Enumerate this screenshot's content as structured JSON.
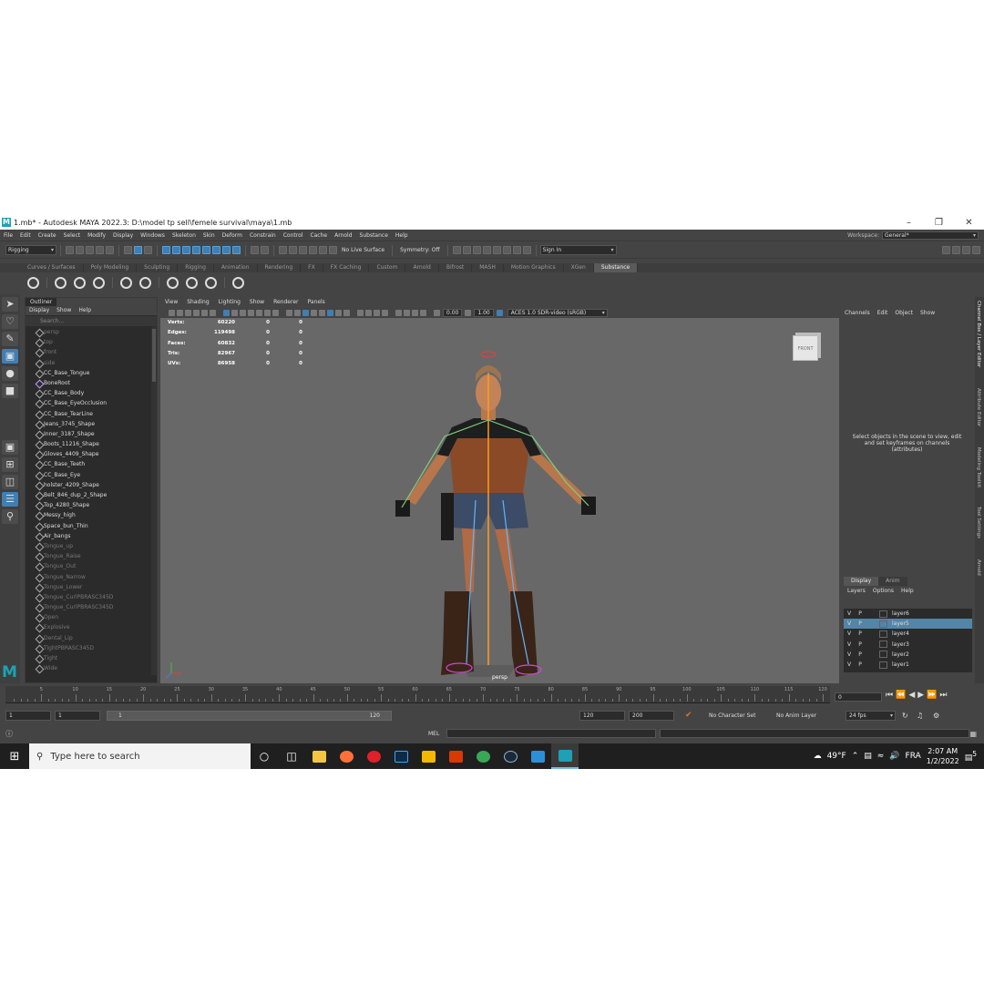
{
  "titlebar": {
    "title": "1.mb* - Autodesk MAYA 2022.3: D:\\model tp sell\\femele survival\\maya\\1.mb",
    "icon": "maya-icon",
    "controls": [
      "minimize-icon",
      "maximize-icon",
      "close-icon"
    ]
  },
  "menubar": {
    "items": [
      "File",
      "Edit",
      "Create",
      "Select",
      "Modify",
      "Display",
      "Windows",
      "Skeleton",
      "Skin",
      "Deform",
      "Constrain",
      "Control",
      "Cache",
      "Arnold",
      "Substance",
      "Help"
    ],
    "workspace_label": "Workspace:",
    "workspace_value": "General*"
  },
  "statusline": {
    "mode": "Rigging",
    "live_surface": "No Live Surface",
    "symmetry": "Symmetry: Off",
    "sign_in": "Sign In"
  },
  "shelf": {
    "tabs": [
      "Curves / Surfaces",
      "Poly Modeling",
      "Sculpting",
      "Rigging",
      "Animation",
      "Rendering",
      "FX",
      "FX Caching",
      "Custom",
      "Arnold",
      "Bifrost",
      "MASH",
      "Motion Graphics",
      "XGen",
      "Substance"
    ],
    "active": "Substance"
  },
  "outliner": {
    "title": "Outliner",
    "menu": [
      "Display",
      "Show",
      "Help"
    ],
    "search_placeholder": "Search...",
    "items": [
      {
        "name": "persp",
        "dim": true
      },
      {
        "name": "top",
        "dim": true
      },
      {
        "name": "front",
        "dim": true
      },
      {
        "name": "side",
        "dim": true
      },
      {
        "name": "CC_Base_Tongue",
        "dim": false
      },
      {
        "name": "BoneRoot",
        "dim": false,
        "joint": true
      },
      {
        "name": "CC_Base_Body",
        "dim": false
      },
      {
        "name": "CC_Base_EyeOcclusion",
        "dim": false
      },
      {
        "name": "CC_Base_TearLine",
        "dim": false
      },
      {
        "name": "Jeans_3745_Shape",
        "dim": false
      },
      {
        "name": "Inner_3187_Shape",
        "dim": false
      },
      {
        "name": "Boots_11216_Shape",
        "dim": false
      },
      {
        "name": "Gloves_4409_Shape",
        "dim": false
      },
      {
        "name": "CC_Base_Teeth",
        "dim": false
      },
      {
        "name": "CC_Base_Eye",
        "dim": false
      },
      {
        "name": "holster_4209_Shape",
        "dim": false
      },
      {
        "name": "Belt_846_dup_2_Shape",
        "dim": false
      },
      {
        "name": "Top_4280_Shape",
        "dim": false
      },
      {
        "name": "Messy_high",
        "dim": false
      },
      {
        "name": "Space_bun_Thin",
        "dim": false
      },
      {
        "name": "Air_bangs",
        "dim": false
      },
      {
        "name": "Tongue_up",
        "dim": true
      },
      {
        "name": "Tongue_Raise",
        "dim": true
      },
      {
        "name": "Tongue_Out",
        "dim": true
      },
      {
        "name": "Tongue_Narrow",
        "dim": true
      },
      {
        "name": "Tongue_Lower",
        "dim": true
      },
      {
        "name": "Tongue_CurlPBRASC345D",
        "dim": true
      },
      {
        "name": "Tongue_CurlPBRASC345D",
        "dim": true
      },
      {
        "name": "Open",
        "dim": true
      },
      {
        "name": "Explosive",
        "dim": true
      },
      {
        "name": "Dental_Lip",
        "dim": true
      },
      {
        "name": "TightPBRASC345D",
        "dim": true
      },
      {
        "name": "Tight",
        "dim": true
      },
      {
        "name": "Wide",
        "dim": true
      }
    ]
  },
  "viewport": {
    "menu": [
      "View",
      "Shading",
      "Lighting",
      "Show",
      "Renderer",
      "Panels"
    ],
    "exposure": "0.00",
    "gamma": "1.00",
    "color_space": "ACES 1.0 SDR-video (sRGB)",
    "hud": [
      {
        "label": "Verts:",
        "v1": "60220",
        "v2": "0",
        "v3": "0"
      },
      {
        "label": "Edges:",
        "v1": "119498",
        "v2": "0",
        "v3": "0"
      },
      {
        "label": "Faces:",
        "v1": "60832",
        "v2": "0",
        "v3": "0"
      },
      {
        "label": "Tris:",
        "v1": "82967",
        "v2": "0",
        "v3": "0"
      },
      {
        "label": "UVs:",
        "v1": "86958",
        "v2": "0",
        "v3": "0"
      }
    ],
    "view_cube": "FRONT",
    "camera": "persp"
  },
  "channelbox": {
    "menu": [
      "Channels",
      "Edit",
      "Object",
      "Show"
    ],
    "hint": "Select objects in the scene to view, edit and set keyframes on channels (attributes)",
    "side_tabs": [
      "Channel Box / Layer Editor",
      "Attribute Editor",
      "Modeling Toolkit",
      "Tool Settings",
      "Arnold"
    ]
  },
  "layers": {
    "tabs": [
      "Display",
      "Anim"
    ],
    "menu": [
      "Layers",
      "Options",
      "Help"
    ],
    "rows": [
      {
        "v": "V",
        "p": "P",
        "name": "layer6",
        "sel": false
      },
      {
        "v": "V",
        "p": "P",
        "name": "layer5",
        "sel": true
      },
      {
        "v": "V",
        "p": "P",
        "name": "layer4",
        "sel": false
      },
      {
        "v": "V",
        "p": "P",
        "name": "layer3",
        "sel": false
      },
      {
        "v": "V",
        "p": "P",
        "name": "layer2",
        "sel": false
      },
      {
        "v": "V",
        "p": "P",
        "name": "layer1",
        "sel": false
      }
    ]
  },
  "timeline": {
    "ticks": [
      "5",
      "10",
      "15",
      "20",
      "25",
      "30",
      "35",
      "40",
      "45",
      "50",
      "55",
      "60",
      "65",
      "70",
      "75",
      "80",
      "85",
      "90",
      "95",
      "100",
      "105",
      "110",
      "115",
      "120"
    ],
    "current_frame": "0"
  },
  "range": {
    "start": "1",
    "playback_start": "1",
    "bar_start": "1",
    "bar_end": "120",
    "playback_end": "120",
    "end": "200",
    "character_set": "No Character Set",
    "anim_layer": "No Anim Layer",
    "fps": "24 fps"
  },
  "cmd": {
    "label": "MEL"
  },
  "taskbar": {
    "search_placeholder": "Type here to search",
    "weather": "49°F",
    "language": "FRA",
    "time": "2:07 AM",
    "date": "1/2/2022",
    "notifications": "5",
    "apps": [
      "cortana-icon",
      "task-view-icon",
      "file-explorer-icon",
      "firefox-icon",
      "opera-icon",
      "photoshop-icon",
      "marmoset-icon",
      "office-icon",
      "chrome-icon",
      "steam-icon",
      "photos-icon",
      "maya-taskbar-icon"
    ]
  }
}
